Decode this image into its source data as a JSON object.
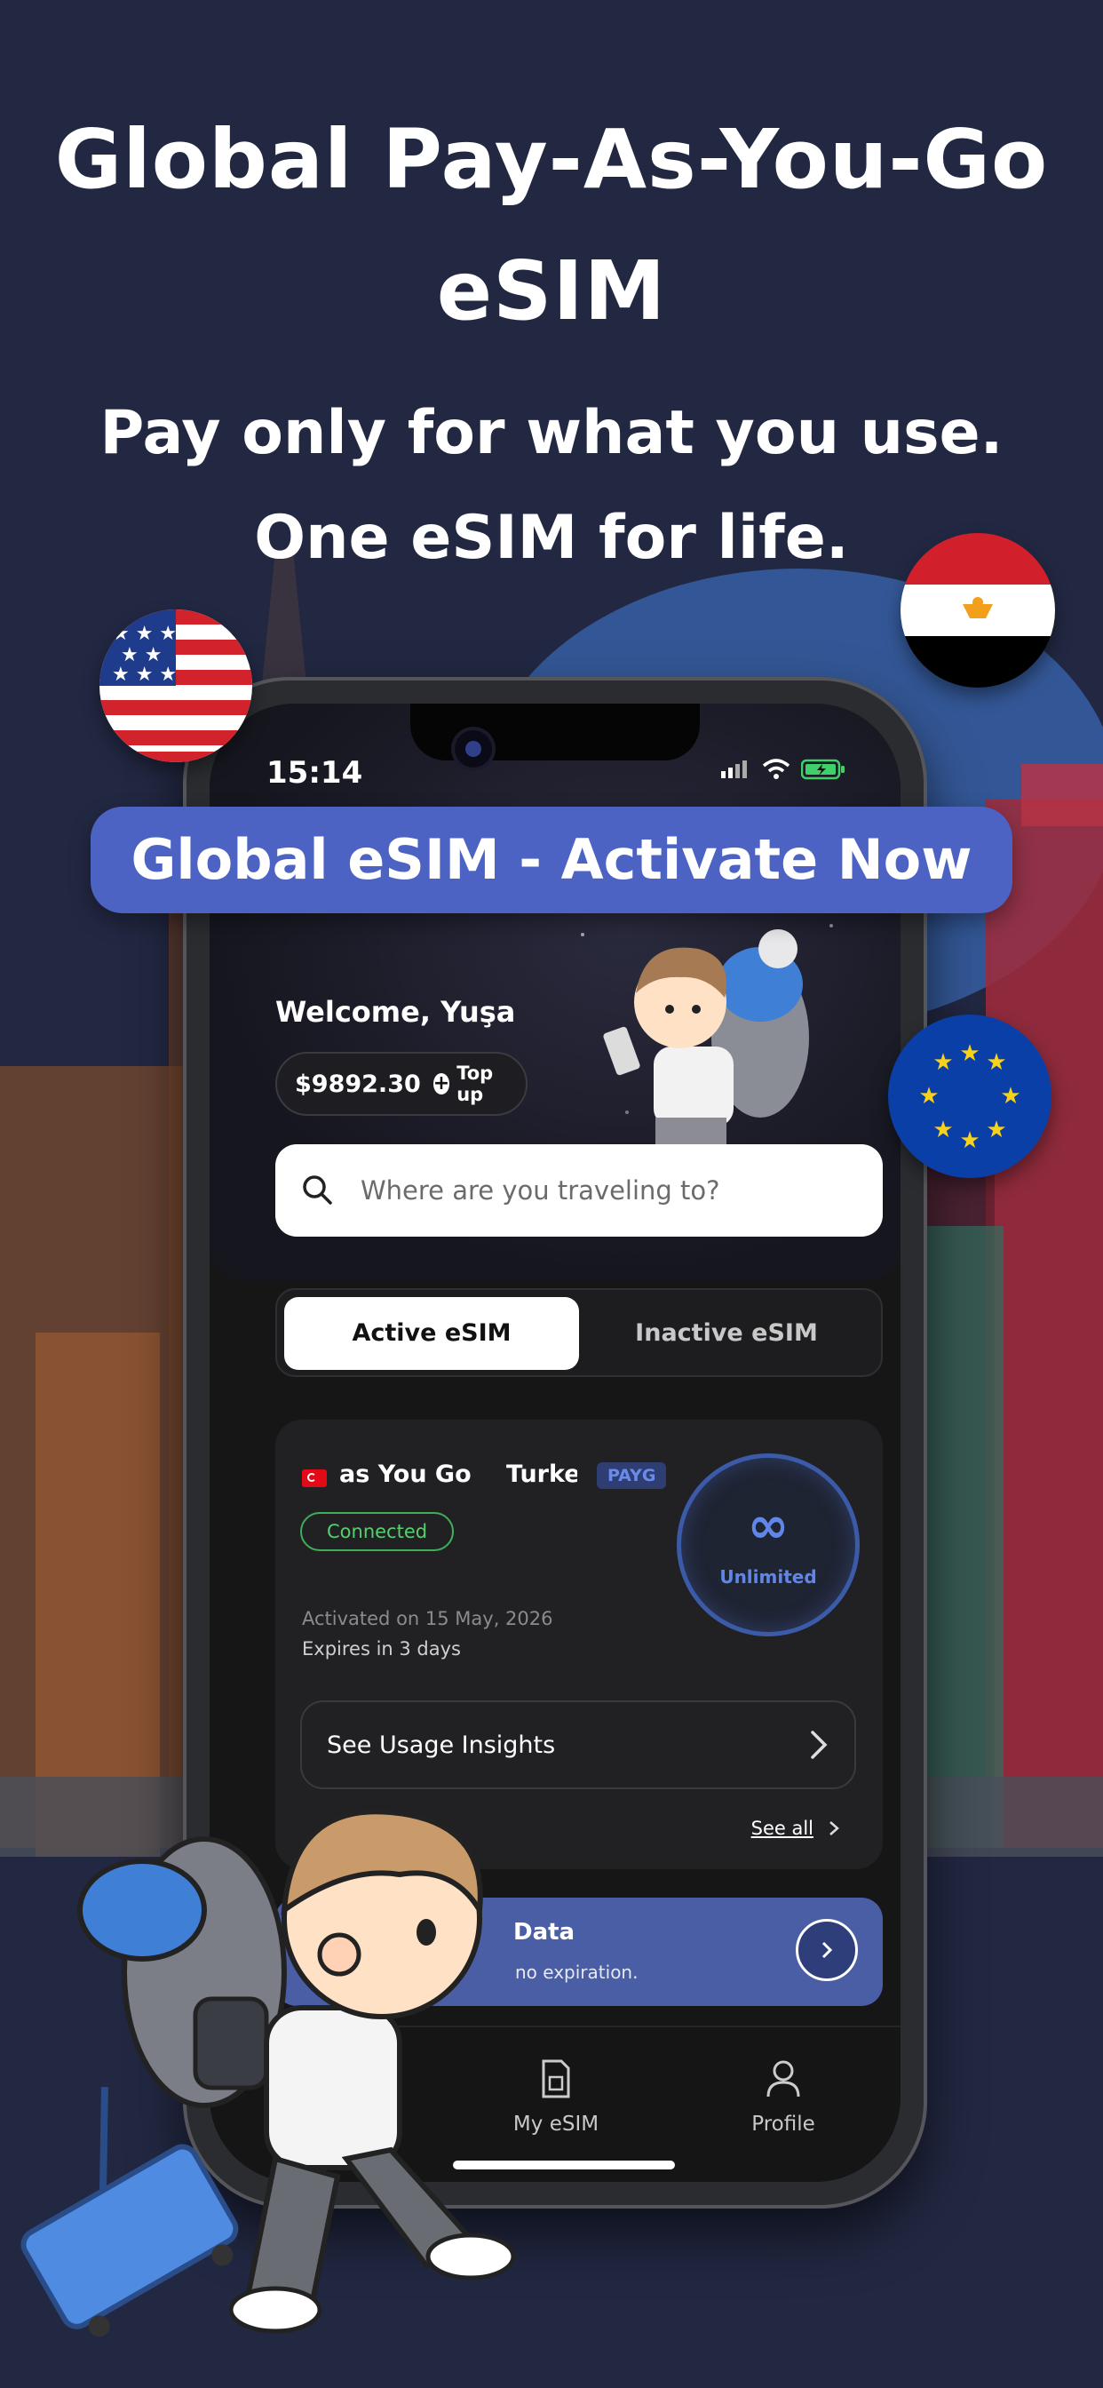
{
  "headline": {
    "line1": "Global Pay-As-You-Go",
    "line2": "eSIM",
    "line3": "Pay only for what you use.",
    "line4": "One eSIM for life."
  },
  "banner": {
    "label": "Global eSIM - Activate Now"
  },
  "status_bar": {
    "time": "15:14"
  },
  "home": {
    "welcome": "Welcome, Yuşa",
    "balance": "$9892.30",
    "topup_label": "Top up",
    "search_placeholder": "Where are you traveling to?"
  },
  "segments": {
    "active": "Active eSIM",
    "inactive": "Inactive eSIM"
  },
  "esim_card": {
    "plan_name": "as You Go",
    "country": "Turkey",
    "tag": "PAYG",
    "status": "Connected",
    "activated": "Activated on 15 May, 2026",
    "expires": "Expires in 3 days",
    "data_symbol": "∞",
    "data_label": "Unlimited",
    "insights_label": "See Usage Insights",
    "see_all": "See all"
  },
  "promo": {
    "title": "Data",
    "subtitle": "no expiration."
  },
  "tabbar": {
    "items": [
      {
        "label": "My eSIM"
      },
      {
        "label": "Profile"
      }
    ]
  },
  "colors": {
    "background": "#222842",
    "accent": "#4d63c4",
    "connected": "#55d06f",
    "unlimited": "#5f86e8"
  },
  "icons": [
    "us-flag-icon",
    "egypt-flag-icon",
    "eu-flag-icon",
    "search-icon",
    "plus-icon",
    "chevron-right-icon",
    "sim-icon",
    "person-icon",
    "infinity-icon",
    "wifi-icon",
    "battery-icon",
    "signal-icon"
  ]
}
